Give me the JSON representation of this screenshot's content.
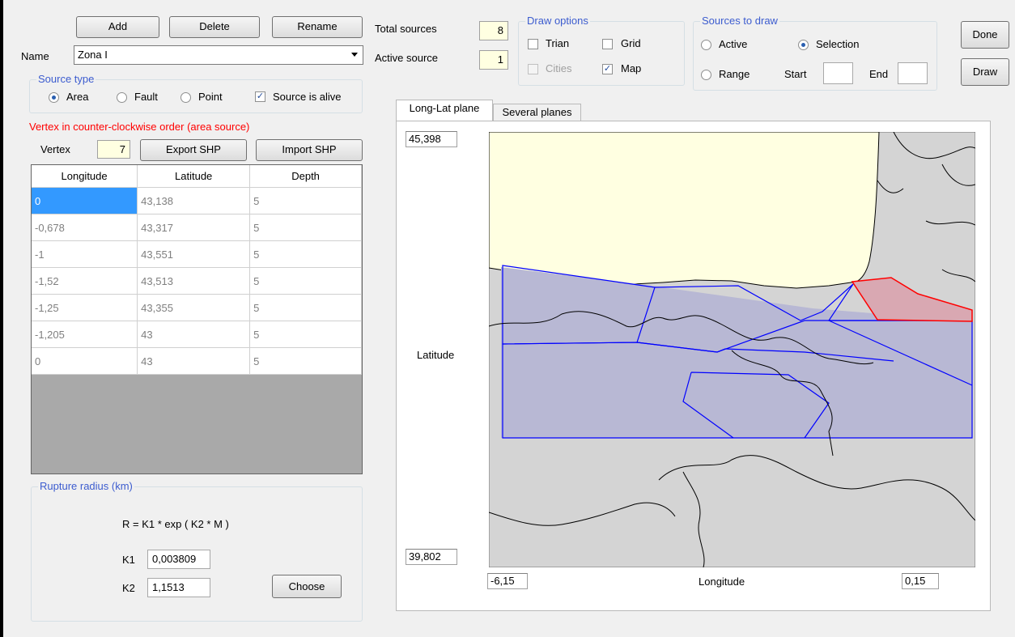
{
  "toolbar": {
    "add_label": "Add",
    "delete_label": "Delete",
    "rename_label": "Rename"
  },
  "name_field": {
    "label": "Name",
    "value": "Zona I"
  },
  "source_type": {
    "title": "Source type",
    "options": [
      "Area",
      "Fault",
      "Point"
    ],
    "selected": "Area",
    "alive_label": "Source is alive",
    "alive_checked": true
  },
  "vertex_note": "Vertex in counter-clockwise order (area source)",
  "vertex": {
    "label": "Vertex",
    "count": "7",
    "export_label": "Export SHP",
    "import_label": "Import SHP"
  },
  "table": {
    "columns": [
      "Longitude",
      "Latitude",
      "Depth"
    ],
    "rows": [
      [
        "0",
        "43,138",
        "5"
      ],
      [
        "-0,678",
        "43,317",
        "5"
      ],
      [
        "-1",
        "43,551",
        "5"
      ],
      [
        "-1,52",
        "43,513",
        "5"
      ],
      [
        "-1,25",
        "43,355",
        "5"
      ],
      [
        "-1,205",
        "43",
        "5"
      ],
      [
        "0",
        "43",
        "5"
      ]
    ]
  },
  "rupture": {
    "title": "Rupture radius (km)",
    "formula": "R = K1 * exp ( K2 * M )",
    "k1_label": "K1",
    "k1_value": "0,003809",
    "k2_label": "K2",
    "k2_value": "1,1513",
    "choose_label": "Choose"
  },
  "sources": {
    "total_label": "Total sources",
    "total_value": "8",
    "active_label": "Active source",
    "active_value": "1"
  },
  "draw_options": {
    "title": "Draw options",
    "trian_label": "Trian",
    "trian_checked": false,
    "grid_label": "Grid",
    "grid_checked": false,
    "cities_label": "Cities",
    "cities_checked": false,
    "map_label": "Map",
    "map_checked": true
  },
  "sources_to_draw": {
    "title": "Sources to draw",
    "active_label": "Active",
    "selection_label": "Selection",
    "range_label": "Range",
    "start_label": "Start",
    "end_label": "End",
    "selected": "Selection"
  },
  "buttons": {
    "done_label": "Done",
    "draw_label": "Draw"
  },
  "tabs": [
    {
      "label": "Long-Lat plane",
      "active": true
    },
    {
      "label": "Several planes",
      "active": false
    }
  ],
  "map": {
    "lat_max": "45,398",
    "lat_min": "39,802",
    "lon_min": "-6,15",
    "lon_max": "0,15",
    "y_axis_label": "Latitude",
    "x_axis_label": "Longitude",
    "colors": {
      "sea": "#ffffe1",
      "land": "#d4d4d4",
      "zone": "#0000ff",
      "zone_fill": "#b8b8d4",
      "active_zone": "#ff0000",
      "active_fill": "#d9a8b2"
    }
  }
}
